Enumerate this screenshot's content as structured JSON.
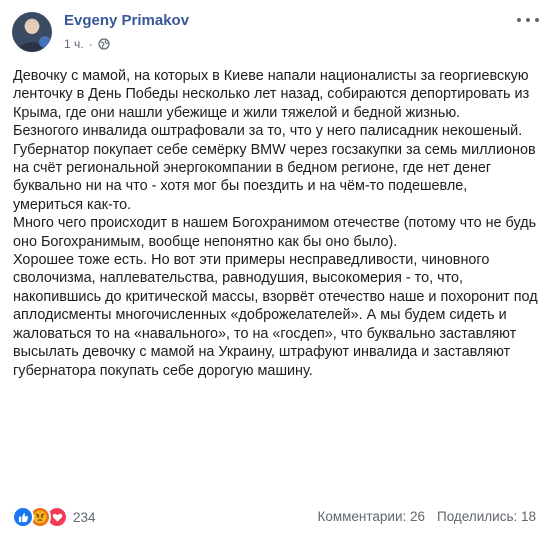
{
  "header": {
    "author": "Evgeny Primakov",
    "time": "1 ч.",
    "separator": "·",
    "privacy_icon": "globe-icon",
    "menu_icon": "more-options-icon"
  },
  "post": {
    "paragraphs": [
      "Девочку с мамой, на которых в Киеве напали националисты за георгиевскую ленточку в День Победы несколько лет назад, собираются депортировать из Крыма, где они нашли убежище и жили тяжелой и бедной жизнью.",
      "Безногого инвалида оштрафовали за то, что у него палисадник некошеный.",
      "Губернатор покупает себе семёрку BMW через госзакупки за семь миллионов на счёт региональной энергокомпании в бедном регионе, где нет денег буквально ни на что - хотя мог бы поездить и на чём-то подешевле, умериться как-то.",
      "Много чего происходит в нашем Богохранимом отечестве (потому что не будь оно Богохранимым, вообще непонятно как бы оно было).",
      "Хорошее тоже есть. Но вот эти примеры несправедливости, чиновного сволочизма, наплевательства, равнодушия, высокомерия - то, что, накопившись до критической массы, взорвёт отечество наше и похоронит под аплодисменты многочисленных «доброжелателей». А мы будем сидеть и жаловаться то на «навального», то на «госдеп», что буквально заставляют высылать девочку с мамой на Украину, штрафуют инвалида и заставляют губернатора покупать себе дорогую машину."
    ]
  },
  "footer": {
    "reactions": [
      "like-icon",
      "angry-icon",
      "love-icon"
    ],
    "reaction_count": "234",
    "comments": "Комментарии: 26",
    "shares": "Поделились: 18"
  },
  "colors": {
    "author": "#385898",
    "meta": "#606770",
    "text": "#1c1e21",
    "like": "#1877f2",
    "angry": "#e9710f",
    "love": "#f33e58"
  }
}
